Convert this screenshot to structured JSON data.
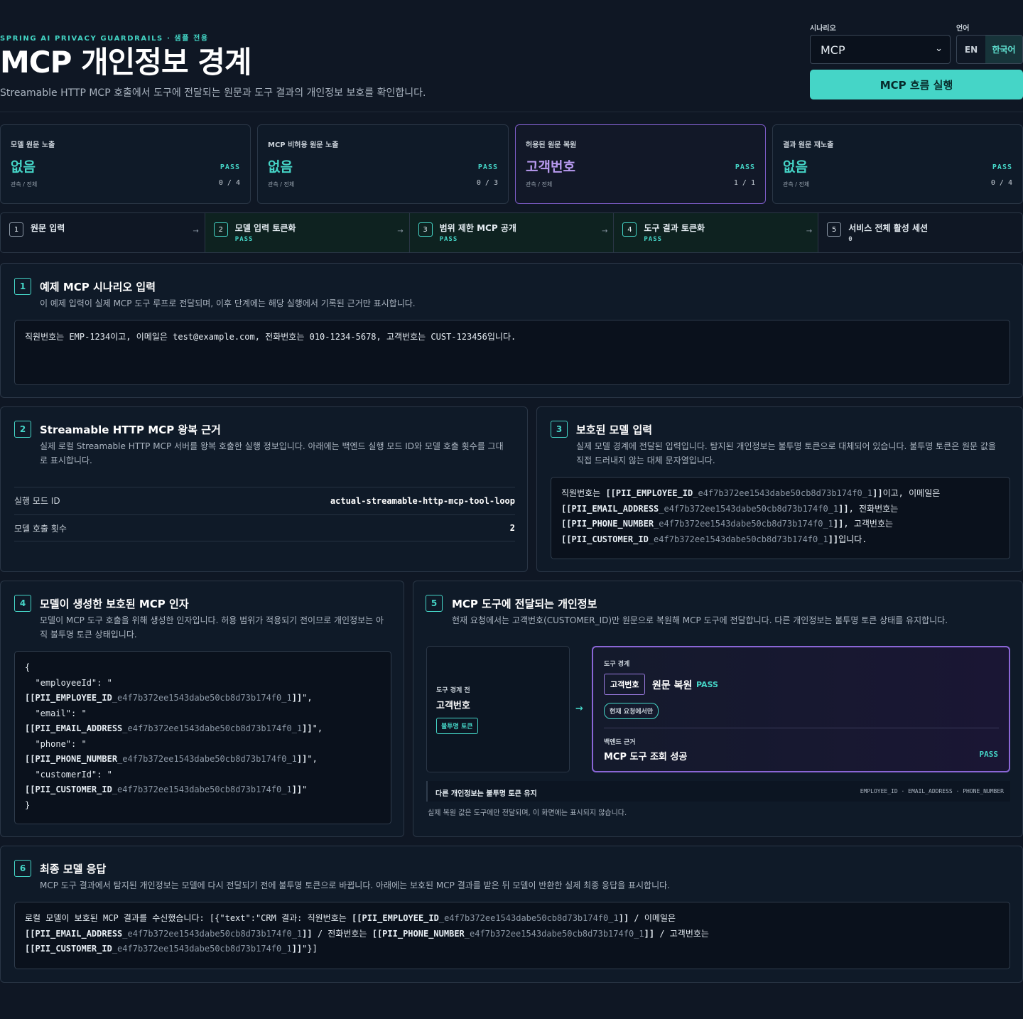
{
  "header": {
    "eyebrow": "SPRING AI PRIVACY GUARDRAILS · 샘플 전용",
    "title": "MCP 개인정보 경계",
    "subtitle": "Streamable HTTP MCP 호출에서 도구에 전달되는 원문과 도구 결과의 개인정보 보호를 확인합니다.",
    "scenario_label": "시나리오",
    "scenario_value": "MCP",
    "language_label": "언어",
    "lang_en": "EN",
    "lang_ko": "한국어",
    "run_button": "MCP 흐름 실행"
  },
  "metrics": [
    {
      "title": "모델 원문 노출",
      "value": "없음",
      "status": "PASS",
      "ratio_label": "관측 / 전체",
      "ratio": "0 / 4"
    },
    {
      "title": "MCP 비허용 원문 노출",
      "value": "없음",
      "status": "PASS",
      "ratio_label": "관측 / 전체",
      "ratio": "0 / 3"
    },
    {
      "title": "허용된 원문 복원",
      "value": "고객번호",
      "status": "PASS",
      "ratio_label": "관측 / 전체",
      "ratio": "1 / 1"
    },
    {
      "title": "결과 원문 재노출",
      "value": "없음",
      "status": "PASS",
      "ratio_label": "관측 / 전체",
      "ratio": "0 / 4"
    }
  ],
  "steps": [
    {
      "num": "1",
      "label": "원문 입력",
      "status": ""
    },
    {
      "num": "2",
      "label": "모델 입력 토큰화",
      "status": "PASS"
    },
    {
      "num": "3",
      "label": "범위 제한 MCP 공개",
      "status": "PASS"
    },
    {
      "num": "4",
      "label": "도구 결과 토큰화",
      "status": "PASS"
    },
    {
      "num": "5",
      "label": "서비스 전체 활성 세션",
      "status": "0"
    }
  ],
  "p1": {
    "num": "1",
    "title": "예제 MCP 시나리오 입력",
    "desc": "이 예제 입력이 실제 MCP 도구 루프로 전달되며, 이후 단계에는 해당 실행에서 기록된 근거만 표시합니다.",
    "input": "직원번호는 EMP-1234이고, 이메일은 test@example.com, 전화번호는 010-1234-5678, 고객번호는 CUST-123456입니다."
  },
  "p2": {
    "num": "2",
    "title": "Streamable HTTP MCP 왕복 근거",
    "desc1": "실제 로컬 Streamable HTTP MCP 서버를 왕복 호출한 실행 정보입니다. 아래에는 백엔드 실행 모드 ID와 모델 호출 횟수를 그대",
    "desc2": "로 표시합니다.",
    "rows": [
      {
        "key": "실행 모드 ID",
        "value": "actual-streamable-http-mcp-tool-loop"
      },
      {
        "key": "모델 호출 횟수",
        "value": "2"
      }
    ]
  },
  "tok": {
    "emp": "[[PII_EMPLOYEE_ID",
    "email": "[[PII_EMAIL_ADDRESS",
    "phone": "[[PII_PHONE_NUMBER",
    "cust": "[[PII_CUSTOMER_ID",
    "hash": "_e4f7b372ee1543dabe50cb8d73b174f0_1",
    "close": "]]"
  },
  "p3": {
    "num": "3",
    "title": "보호된 모델 입력",
    "desc1": "실제 모델 경계에 전달된 입력입니다. 탐지된 개인정보는 불투명 토큰으로 대체되어 있습니다. 불투명 토큰은 원문 값을",
    "desc2": "직접 드러내지 않는 대체 문자열입니다.",
    "l1_pre": "직원번호는 ",
    "l1_post": "이고, 이메일은",
    "l2_post": ", 전화번호는",
    "l3_post": ", 고객번호는",
    "l4_post": "입니다."
  },
  "p4": {
    "num": "4",
    "title": "모델이 생성한 보호된 MCP 인자",
    "desc1": "모델이 MCP 도구 호출을 위해 생성한 인자입니다. 허용 범위가 적용되기 전이므로 개인정보는 아",
    "desc2": "직 불투명 토큰 상태입니다.",
    "open": "{",
    "k1": "  \"employeeId\": \"",
    "k2": "  \"email\": \"",
    "k3": "  \"phone\": \"",
    "k4": "  \"customerId\": \"",
    "q_comma": "\",",
    "q": "\"",
    "close": "}"
  },
  "p5": {
    "num": "5",
    "title": "MCP 도구에 전달되는 개인정보",
    "desc": "현재 요청에서는 고객번호(CUSTOMER_ID)만 원문으로 복원해 MCP 도구에 전달합니다. 다른 개인정보는 불투명 토큰 상태를 유지합니다.",
    "before_label": "도구 경계 전",
    "before_value": "고객번호",
    "before_chip": "불투명 토큰",
    "arrow": "→",
    "boundary_label": "도구 경계",
    "boundary_chip": "고객번호",
    "restore_label": "원문 복원",
    "restore_status": "PASS",
    "scope_pill": "현재 요청에서만",
    "backend_label": "백엔드 근거",
    "backend_value": "MCP 도구 조회 성공",
    "backend_status": "PASS",
    "keep_label": "다른 개인정보는 불투명 토큰 유지",
    "keep_types": "EMPLOYEE_ID · EMAIL_ADDRESS · PHONE_NUMBER",
    "note": "실제 복원 값은 도구에만 전달되며, 이 화면에는 표시되지 않습니다."
  },
  "p6": {
    "num": "6",
    "title": "최종 모델 응답",
    "desc": "MCP 도구 결과에서 탐지된 개인정보는 모델에 다시 전달되기 전에 불투명 토큰으로 바뀝니다. 아래에는 보호된 MCP 결과를 받은 뒤 모델이 반환한 실제 최종 응답을 표시합니다.",
    "l1_pre": "로컬 모델이 보호된 MCP 결과를 수신했습니다: [{\"text\":\"CRM 결과: 직원번호는 ",
    "l1_post": " / 이메일은",
    "l2_post": " / 전화번호는 ",
    "l2_end": " / 고객번호는",
    "l3_post": "\"}]"
  },
  "colors": {
    "accent": "#45d5c7",
    "purple": "#7d5cc7",
    "bg": "#0f1724"
  },
  "icons": {
    "chevron": "chevron-down-icon",
    "arrow": "arrow-right-icon"
  }
}
